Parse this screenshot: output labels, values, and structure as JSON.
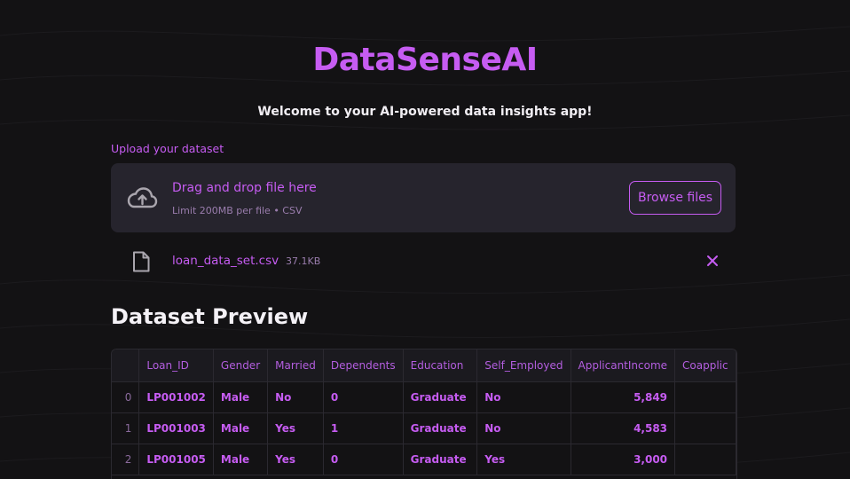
{
  "app": {
    "title": "DataSenseAI",
    "welcome": "Welcome to your AI-powered data insights app!"
  },
  "upload": {
    "label": "Upload your dataset",
    "drop_title": "Drag and drop file here",
    "limit": "Limit 200MB per file • CSV",
    "browse_label": "Browse files",
    "icon": "cloud-upload-icon"
  },
  "file": {
    "name": "loan_data_set.csv",
    "size": "37.1KB",
    "icon": "file-icon",
    "remove_icon": "close-icon"
  },
  "preview": {
    "title": "Dataset Preview",
    "columns": [
      "",
      "Loan_ID",
      "Gender",
      "Married",
      "Dependents",
      "Education",
      "Self_Employed",
      "ApplicantIncome",
      "Coapplic"
    ],
    "rows": [
      {
        "index": "0",
        "Loan_ID": "LP001002",
        "Gender": "Male",
        "Married": "No",
        "Dependents": "0",
        "Education": "Graduate",
        "Self_Employed": "No",
        "ApplicantIncome": "5,849",
        "Coapplic": ""
      },
      {
        "index": "1",
        "Loan_ID": "LP001003",
        "Gender": "Male",
        "Married": "Yes",
        "Dependents": "1",
        "Education": "Graduate",
        "Self_Employed": "No",
        "ApplicantIncome": "4,583",
        "Coapplic": ""
      },
      {
        "index": "2",
        "Loan_ID": "LP001005",
        "Gender": "Male",
        "Married": "Yes",
        "Dependents": "0",
        "Education": "Graduate",
        "Self_Employed": "Yes",
        "ApplicantIncome": "3,000",
        "Coapplic": ""
      }
    ]
  },
  "colors": {
    "accent": "#c65cf2",
    "background": "#131214",
    "panel": "#26242d"
  }
}
